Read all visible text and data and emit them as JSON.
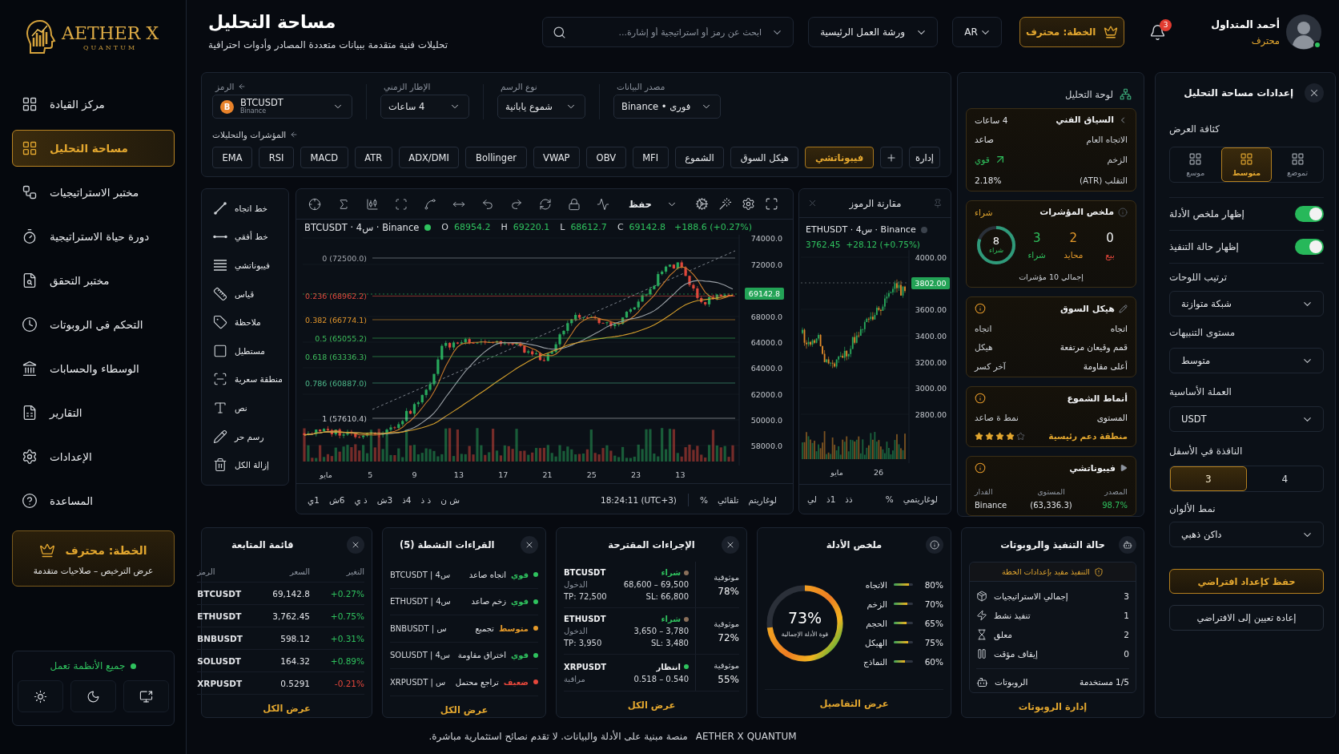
{
  "sidebar": {
    "logo": {
      "name": "AETHER X",
      "tagline": "QUANTUM"
    },
    "items": [
      {
        "label": "مركز القيادة",
        "selected": false
      },
      {
        "label": "مساحة التحليل",
        "selected": true
      },
      {
        "label": "مختبر الاستراتيجيات",
        "selected": false
      },
      {
        "label": "دورة حياة الاستراتيجية",
        "selected": false
      },
      {
        "label": "مختبر التحقق",
        "selected": false
      },
      {
        "label": "التحكم في الروبوتات",
        "selected": false
      },
      {
        "label": "الوسطاء والحسابات",
        "selected": false
      },
      {
        "label": "التقارير",
        "selected": false
      },
      {
        "label": "الإعدادات",
        "selected": false
      },
      {
        "label": "المساعدة",
        "selected": false
      }
    ],
    "plan_card": {
      "title": "الخطة: محترف",
      "subtitle": "عرض الترخيص – صلاحيات متقدمة"
    },
    "system_status": {
      "label": "جميع الأنظمة تعمل",
      "online": true
    }
  },
  "header": {
    "title": "مساحة التحليل",
    "subtitle": "تحليلات فنية متقدمة ببيانات متعددة المصادر وأدوات احترافية",
    "search": {
      "placeholder": "ابحث عن رمز أو استراتيجية أو إشارة..."
    },
    "workspace": "ورشة العمل الرئيسية",
    "language": "AR",
    "plan_button": "الخطة: محترف",
    "notifications": "3",
    "user": {
      "name": "أحمد المتداول",
      "role": "محترف",
      "online": true
    }
  },
  "controls": {
    "fields": [
      {
        "label": "مصدر البيانات",
        "value": "Binance • فورى"
      },
      {
        "label": "نوع الرسم",
        "value": "شموع يابانية"
      },
      {
        "label": "الإطار الزمني",
        "value": "4 ساعات"
      },
      {
        "label": "الرمز",
        "value": "BTCUSDT",
        "sub": "Binance",
        "coin": "B"
      }
    ],
    "indicators_label": "المؤشرات والتحليلات",
    "manage": "إدارة",
    "chips": [
      {
        "label": "فيبوناتشي",
        "selected": true
      },
      {
        "label": "هيكل السوق",
        "selected": false
      },
      {
        "label": "الشموع",
        "selected": false
      },
      {
        "label": "MFI",
        "selected": false
      },
      {
        "label": "OBV",
        "selected": false
      },
      {
        "label": "VWAP",
        "selected": false
      },
      {
        "label": "Bollinger",
        "selected": false
      },
      {
        "label": "ADX/DMI",
        "selected": false
      },
      {
        "label": "ATR",
        "selected": false
      },
      {
        "label": "MACD",
        "selected": false
      },
      {
        "label": "RSI",
        "selected": false
      },
      {
        "label": "EMA",
        "selected": false
      }
    ]
  },
  "drawing_tools": [
    {
      "label": "خط اتجاه"
    },
    {
      "label": "خط أفقي"
    },
    {
      "label": "فيبوناتشي"
    },
    {
      "label": "قياس"
    },
    {
      "label": "ملاحظة"
    },
    {
      "label": "مستطيل"
    },
    {
      "label": "منطقة سعرية"
    },
    {
      "label": "نص"
    },
    {
      "label": "رسم حر"
    },
    {
      "label": "إزالة الكل"
    }
  ],
  "main_chart": {
    "save_label": "حفظ",
    "title": "BTCUSDT · 4س · Binance",
    "live": true,
    "ohlc": {
      "open": {
        "key": "O",
        "value": "68954.2"
      },
      "high": {
        "key": "H",
        "value": "69220.1"
      },
      "low": {
        "key": "L",
        "value": "68612.7"
      },
      "close": {
        "key": "C",
        "value": "69142.8"
      }
    },
    "change": "+188.6 (+0.27%)",
    "fib_levels": [
      {
        "label": "0 (72500.0)",
        "color": "#a3a7ae"
      },
      {
        "label": "0.236 (68962.2)",
        "color": "#e0483c"
      },
      {
        "label": "0.382 (66774.1)",
        "color": "#e0952c"
      },
      {
        "label": "0.5 (65055.2)",
        "color": "#3dbf5c"
      },
      {
        "label": "0.618 (63336.3)",
        "color": "#3fbf5e"
      },
      {
        "label": "0.786 (60887.0)",
        "color": "#4db88a"
      },
      {
        "label": "1 (57610.4)",
        "color": "#c9ccd1"
      }
    ],
    "price_labels": [
      "74000.0",
      "72000.0",
      "68000.0",
      "64000.0",
      "64000.0",
      "62000.0",
      "50000.0",
      "58000.0"
    ],
    "last_price": "69142.8",
    "x_labels": [
      "13",
      "23",
      "25",
      "21",
      "17",
      "13",
      "9",
      "5",
      "مايو"
    ],
    "scale_options": [
      "لوغاريتم",
      "تلقائي",
      "%"
    ],
    "time": "18:24:11 (UTC+3)",
    "timeframes": [
      "ش ن",
      "ذ ذ",
      "4ذ",
      "3ش",
      "ذ ي",
      "6ش",
      "1ي"
    ]
  },
  "compare_chart": {
    "title": "مقارنة الرموز",
    "symbol": "ETHUSDT · 4س · Binance",
    "live": false,
    "price": "3762.45",
    "change": "+28.12 (+0.75%)",
    "price_labels": [
      "4000.00",
      "3600.00",
      "3400.00",
      "3200.00",
      "3000.00",
      "2800.00"
    ],
    "last_price": "3802.00",
    "x_labels": [
      "26",
      "مايو"
    ],
    "scale_options": [
      "لوغاريتمي",
      "%"
    ],
    "timeframes": [
      "ذذ",
      "1ذ",
      "لي"
    ]
  },
  "analysis_board": {
    "title": "لوحة التحليل",
    "technical_context": {
      "title": "السياق الفني",
      "timeframe": "4 ساعات",
      "rows": [
        {
          "label": "الاتجاه العام",
          "value": "صاعد",
          "kind": "plain"
        },
        {
          "label": "الزخم",
          "value": "قوي",
          "kind": "rising"
        },
        {
          "label": "التقلب (ATR)",
          "value": "2.18%",
          "kind": "plain"
        }
      ]
    },
    "indicators": {
      "title": "ملخص المؤشرات",
      "signal": "شراء",
      "counts": [
        {
          "value": "0",
          "label": "بيع",
          "kind": "sell"
        },
        {
          "value": "2",
          "label": "محايد",
          "kind": "neutral"
        },
        {
          "value": "3",
          "label": "شراء",
          "kind": "buy"
        }
      ],
      "ring": {
        "value": "8",
        "label": "شراء",
        "level": 0.8
      },
      "total": "إجمالي 10 مؤشرات"
    },
    "market_structure": {
      "title": "هيكل السوق",
      "rows": [
        {
          "value": "اتجاه",
          "label": "اتجاه"
        },
        {
          "value": "قمم وقيعان مرتفعة",
          "label": "هيكل"
        },
        {
          "value": "أعلى مقاومة",
          "label": "آخر كسر"
        }
      ]
    },
    "candle_patterns": {
      "title": "أنماط الشموع",
      "level_label": "المستوى",
      "pattern": "نمط ة صاعد",
      "zone": "منطقة دعم رئيسية",
      "stars": 4
    },
    "fibonacci": {
      "title": "فيبوناتشي",
      "columns": [
        "المصدر",
        "المستوى",
        "القدار"
      ],
      "cells": [
        {
          "text": "98.7%",
          "color": "#2fc25e"
        },
        {
          "text": "(63,336.3)",
          "color": "#e2e4e8"
        },
        {
          "text": "Binance",
          "color": "#e2e4e8"
        }
      ]
    }
  },
  "settings": {
    "title": "إعدادات مساحة التحليل",
    "density": {
      "label": "كثافة العرض",
      "options": [
        {
          "label": "تموضع",
          "selected": false
        },
        {
          "label": "متوسط",
          "selected": true
        },
        {
          "label": "موسع",
          "selected": false
        }
      ]
    },
    "toggles": [
      {
        "label": "إظهار ملخص الأدلة",
        "on": true
      },
      {
        "label": "إظهار حالة التنفيذ",
        "on": true
      }
    ],
    "selects": [
      {
        "label": "ترتيب اللوحات",
        "value": "شبكة متوازنة"
      },
      {
        "label": "مستوى التنبيهات",
        "value": "متوسط"
      },
      {
        "label": "العملة الأساسية",
        "value": "USDT"
      }
    ],
    "bottom_windows": {
      "label": "النافذة في الأسفل",
      "options": [
        {
          "label": "4",
          "selected": false
        },
        {
          "label": "3",
          "selected": true
        }
      ]
    },
    "color_theme": {
      "label": "نمط الألوان",
      "value": "داكن ذهبي"
    },
    "save": "حفظ كإعداد افتراضي",
    "reset": "إعادة تعيين إلى الافتراضي"
  },
  "watchlist": {
    "title": "قائمة المتابعة",
    "columns": [
      "التغير",
      "السعر",
      "الرمز"
    ],
    "rows": [
      {
        "change": "+0.27%",
        "price": "69,142.8",
        "symbol": "BTCUSDT",
        "color": "#2fc25e"
      },
      {
        "change": "+0.75%",
        "price": "3,762.45",
        "symbol": "ETHUSDT",
        "color": "#2fc25e"
      },
      {
        "change": "+0.31%",
        "price": "598.12",
        "symbol": "BNBUSDT",
        "color": "#2fc25e"
      },
      {
        "change": "+0.89%",
        "price": "164.32",
        "symbol": "SOLUSDT",
        "color": "#2fc25e"
      },
      {
        "change": "-0.21%",
        "price": "0.5291",
        "symbol": "XRPUSDT",
        "color": "#e5473b"
      }
    ],
    "link": "عرض الكل"
  },
  "active_readings": {
    "title": "القراءات النشطة (5)",
    "rows": [
      {
        "strength": "قوي",
        "color": "#2fc25e",
        "reading": "اتجاه صاعد",
        "symbol": "BTCUSDT | 4س"
      },
      {
        "strength": "قوي",
        "color": "#2fc25e",
        "reading": "زخم صاعد",
        "symbol": "ETHUSDT | 4س"
      },
      {
        "strength": "متوسط",
        "color": "#e59a2a",
        "reading": "تجميع",
        "symbol": "BNBUSDT | س"
      },
      {
        "strength": "قوي",
        "color": "#2fc25e",
        "reading": "اختراق مقاومة",
        "symbol": "SOLUSDT | 4س"
      },
      {
        "strength": "ضعيف",
        "color": "#e5473b",
        "reading": "تراجع محتمل",
        "symbol": "XRPUSDT | س"
      }
    ],
    "link": "عرض الكل"
  },
  "suggested_actions": {
    "title": "الإجراءات المقترحة",
    "rows": [
      {
        "confidence_label": "موثوقية",
        "confidence": "78%",
        "symbol": "BTCUSDT",
        "signal": "شراء",
        "kind": "buy",
        "range_label": "الدخول",
        "range": "68,600 – 69,500",
        "tp": "TP: 72,500",
        "sl": "SL: 66,800"
      },
      {
        "confidence_label": "موثوقية",
        "confidence": "72%",
        "symbol": "ETHUSDT",
        "signal": "شراء",
        "kind": "buy",
        "range_label": "الدخول",
        "range": "3,650 – 3,780",
        "tp": "TP: 3,950",
        "sl": "SL: 3,480"
      },
      {
        "confidence_label": "موثوقية",
        "confidence": "55%",
        "symbol": "XRPUSDT",
        "signal": "انتظار",
        "kind": "wait",
        "range_label": "مراقبة",
        "range": "0.518 – 0.540"
      }
    ],
    "link": "عرض الكل"
  },
  "evidence_summary": {
    "title": "ملخص الأدلة",
    "factors": [
      {
        "label": "الاتجاه",
        "value": "80%",
        "level": 0.8
      },
      {
        "label": "الزخم",
        "value": "70%",
        "level": 0.7
      },
      {
        "label": "الحجم",
        "value": "65%",
        "level": 0.65
      },
      {
        "label": "الهيكل",
        "value": "75%",
        "level": 0.75
      },
      {
        "label": "النماذج",
        "value": "60%",
        "level": 0.6
      }
    ],
    "score": "73%",
    "score_label": "قوة الأدلة الإجمالية",
    "level": 0.73,
    "link": "عرض التفاصيل"
  },
  "execution_status": {
    "title": "حالة التنفيذ والروبوتات",
    "notice": "التنفيذ مقيد بإعدادات الخطة",
    "rows": [
      {
        "label": "إجمالي الاستراتيجيات",
        "value": "3"
      },
      {
        "label": "تنفيذ نشط",
        "value": "1"
      },
      {
        "label": "معلق",
        "value": "2"
      },
      {
        "label": "إيقاف مؤقت",
        "value": "0"
      }
    ],
    "robots": {
      "label": "الروبوتات",
      "value": "1/5 مستخدمة"
    },
    "link": "إدارة الروبوتات"
  },
  "footer": {
    "brand": "AETHER X QUANTUM",
    "disclaimer": "منصة مبنية على الأدلة والبيانات. لا تقدم نصائح استثمارية مباشرة."
  }
}
